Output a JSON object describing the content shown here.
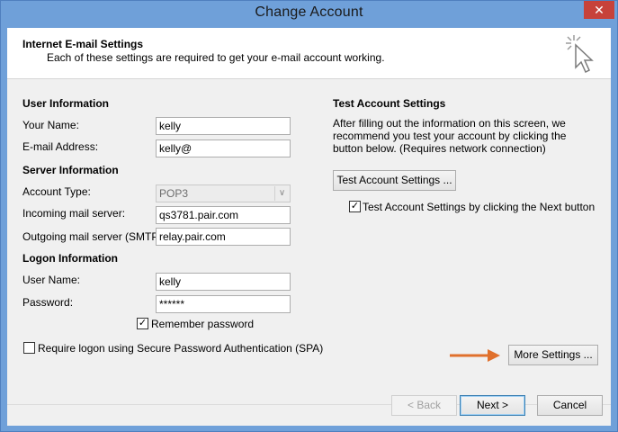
{
  "window": {
    "title": "Change Account",
    "close_glyph": "✕"
  },
  "header": {
    "title": "Internet E-mail Settings",
    "subtitle": "Each of these settings are required to get your e-mail account working.",
    "icon": "wizard-cursor-icon"
  },
  "user_info": {
    "section": "User Information",
    "your_name_label": "Your Name:",
    "your_name_value": "kelly",
    "email_label": "E-mail Address:",
    "email_value": "kelly@"
  },
  "server_info": {
    "section": "Server Information",
    "account_type_label": "Account Type:",
    "account_type_value": "POP3",
    "incoming_label": "Incoming mail server:",
    "incoming_value": "qs3781.pair.com",
    "outgoing_label": "Outgoing mail server (SMTP):",
    "outgoing_value": "relay.pair.com"
  },
  "logon_info": {
    "section": "Logon Information",
    "username_label": "User Name:",
    "username_value": "kelly",
    "password_label": "Password:",
    "password_value": "******",
    "remember_label": "Remember password",
    "remember_checked": true,
    "spa_label": "Require logon using Secure Password Authentication (SPA)",
    "spa_checked": false
  },
  "test_settings": {
    "section": "Test Account Settings",
    "description": "After filling out the information on this screen, we recommend you test your account by clicking the button below. (Requires network connection)",
    "button_label": "Test Account Settings ...",
    "checkbox_label": "Test Account Settings by clicking the Next button",
    "checkbox_checked": true
  },
  "more_settings_label": "More Settings ...",
  "footer": {
    "back_label": "< Back",
    "next_label": "Next >",
    "cancel_label": "Cancel"
  },
  "colors": {
    "title_bar": "#6fa0d9",
    "close_button": "#c7423a",
    "arrow": "#e0702c"
  }
}
